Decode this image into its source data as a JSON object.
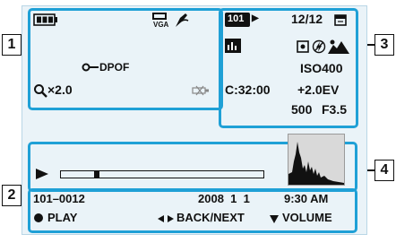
{
  "callouts": [
    "1",
    "2",
    "3",
    "4"
  ],
  "left_panel": {
    "dpof_label": "DPOF",
    "zoom_label": "×2.0",
    "vga_label": "VGA"
  },
  "right_panel": {
    "folder_label": "101",
    "image_count": "12/12",
    "iso": "ISO400",
    "remaining_time": "C:32:00",
    "exposure_comp": "+2.0EV",
    "shutter_speed": "500",
    "aperture": "F3.5"
  },
  "playback": {
    "progress": 0.17
  },
  "bottom_bar": {
    "file_number": "101–0012",
    "date": "2008  1  1",
    "time": "9:30 AM",
    "play_label": "PLAY",
    "back_next_label": "BACK/NEXT",
    "volume_label": "VOLUME"
  },
  "colors": {
    "frame": "#1fa0d6",
    "screen": "#eaf3f8"
  },
  "icons": [
    "battery-icon",
    "vga-icon",
    "pen-icon",
    "dpof-key-icon",
    "zoom-icon",
    "no-connection-icon",
    "folder-icon",
    "play-arrow-icon",
    "memory-card-icon",
    "sound-icon",
    "metering-icon",
    "flash-off-icon",
    "scene-icon",
    "play-icon",
    "histogram-icon",
    "record-dot-icon",
    "back-next-icon",
    "volume-down-icon"
  ]
}
